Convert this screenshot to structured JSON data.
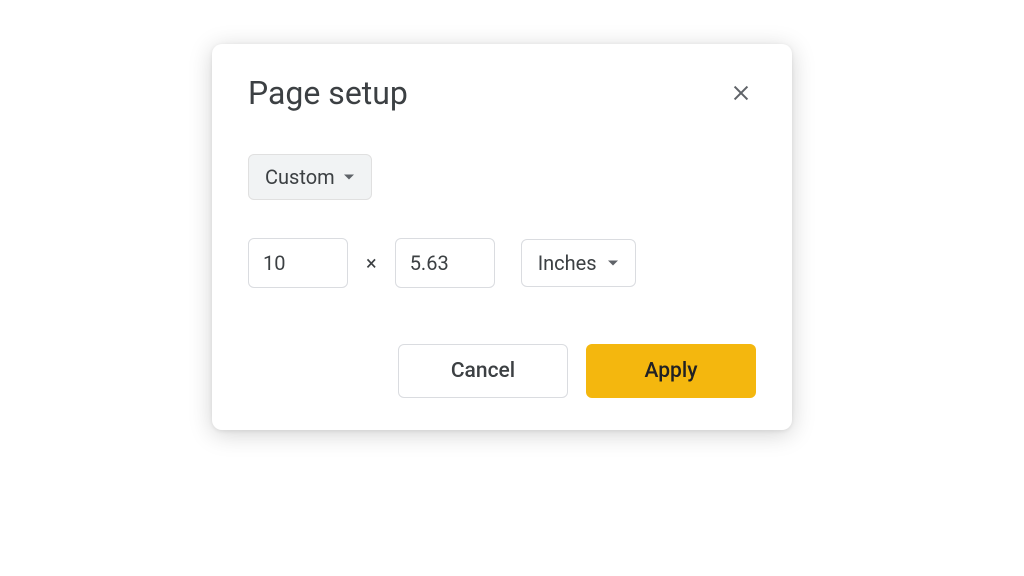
{
  "dialog": {
    "title": "Page setup",
    "preset_label": "Custom",
    "width_value": "10",
    "separator": "×",
    "height_value": "5.63",
    "unit_label": "Inches",
    "cancel_label": "Cancel",
    "apply_label": "Apply"
  },
  "colors": {
    "apply_bg": "#f4b70e"
  }
}
